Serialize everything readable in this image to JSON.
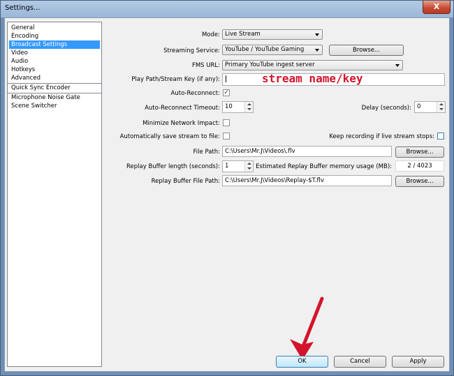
{
  "window": {
    "title": "Settings...",
    "close_glyph": "X"
  },
  "sidebar": {
    "items": [
      {
        "label": "General",
        "selected": false
      },
      {
        "label": "Encoding",
        "selected": false
      },
      {
        "label": "Broadcast Settings",
        "selected": true
      },
      {
        "label": "Video",
        "selected": false
      },
      {
        "label": "Audio",
        "selected": false
      },
      {
        "label": "Hotkeys",
        "selected": false
      },
      {
        "label": "Advanced",
        "selected": false
      }
    ],
    "plugins": [
      {
        "label": "Quick Sync Encoder"
      },
      {
        "label": "Microphone Noise Gate"
      },
      {
        "label": "Scene Switcher"
      }
    ]
  },
  "form": {
    "mode": {
      "label": "Mode:",
      "value": "Live Stream"
    },
    "streaming_service": {
      "label": "Streaming Service:",
      "value": "YouTube / YouTube Gaming",
      "browse": "Browse..."
    },
    "fms_url": {
      "label": "FMS URL:",
      "value": "Primary YouTube ingest server"
    },
    "stream_key": {
      "label": "Play Path/Stream Key (if any):",
      "value": "",
      "overlay": "stream name/key"
    },
    "auto_reconnect": {
      "label": "Auto-Reconnect:",
      "checked": true,
      "mark": "✓"
    },
    "reconnect_timeout": {
      "label": "Auto-Reconnect Timeout:",
      "value": "10"
    },
    "delay": {
      "label": "Delay (seconds):",
      "value": "0"
    },
    "minimize_network": {
      "label": "Minimize Network Impact:",
      "checked": false
    },
    "auto_save": {
      "label": "Automatically save stream to file:",
      "checked": false
    },
    "keep_recording": {
      "label": "Keep recording if live stream stops:",
      "checked": false
    },
    "file_path": {
      "label": "File Path:",
      "value": "C:\\Users\\Mr.J\\Videos\\.flv",
      "browse": "Browse..."
    },
    "replay_length": {
      "label": "Replay Buffer length (seconds):",
      "value": "1"
    },
    "replay_memory": {
      "label": "Estimated Replay Buffer memory usage (MB):",
      "value": "2 / 4023"
    },
    "replay_path": {
      "label": "Replay Buffer File Path:",
      "value": "C:\\Users\\Mr.J\\Videos\\Replay-$T.flv",
      "browse": "Browse..."
    }
  },
  "buttons": {
    "ok": "OK",
    "cancel": "Cancel",
    "apply": "Apply"
  },
  "colors": {
    "selection": "#3399ff",
    "annotation": "#d3152b"
  },
  "annotation": {
    "arrow_icon": "red-arrow-icon"
  }
}
